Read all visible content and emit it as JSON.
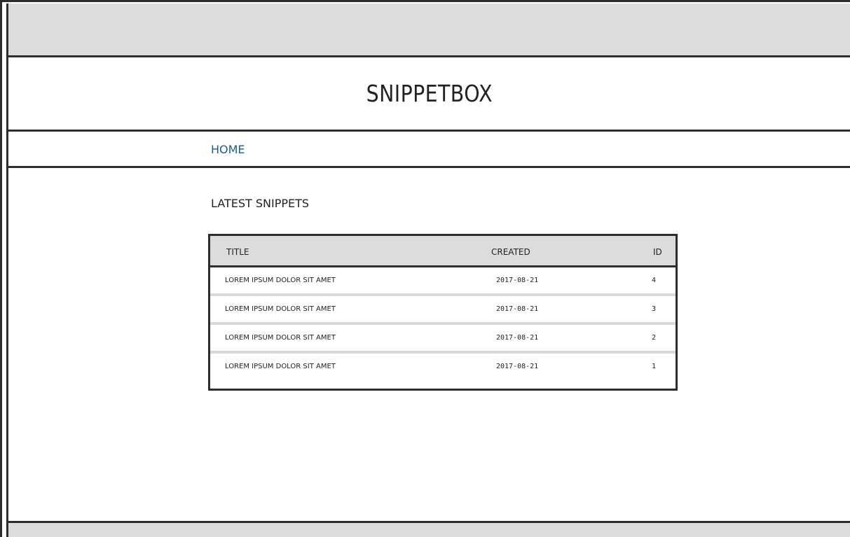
{
  "header": {
    "title": "SNIPPETBOX"
  },
  "nav": {
    "home_label": "HOME"
  },
  "main": {
    "heading": "LATEST SNIPPETS",
    "table": {
      "columns": {
        "title": "TITLE",
        "created": "CREATED",
        "id": "ID"
      },
      "rows": [
        {
          "title": "LOREM IPSUM DOLOR SIT AMET",
          "created": "2017-08-21",
          "id": "4"
        },
        {
          "title": "LOREM IPSUM DOLOR SIT AMET",
          "created": "2017-08-21",
          "id": "3"
        },
        {
          "title": "LOREM IPSUM DOLOR SIT AMET",
          "created": "2017-08-21",
          "id": "2"
        },
        {
          "title": "LOREM IPSUM DOLOR SIT AMET",
          "created": "2017-08-21",
          "id": "1"
        }
      ]
    }
  },
  "colors": {
    "link": "#1a5a96",
    "bar_fill": "#dcdcdc",
    "outline": "#2d2d2d"
  }
}
